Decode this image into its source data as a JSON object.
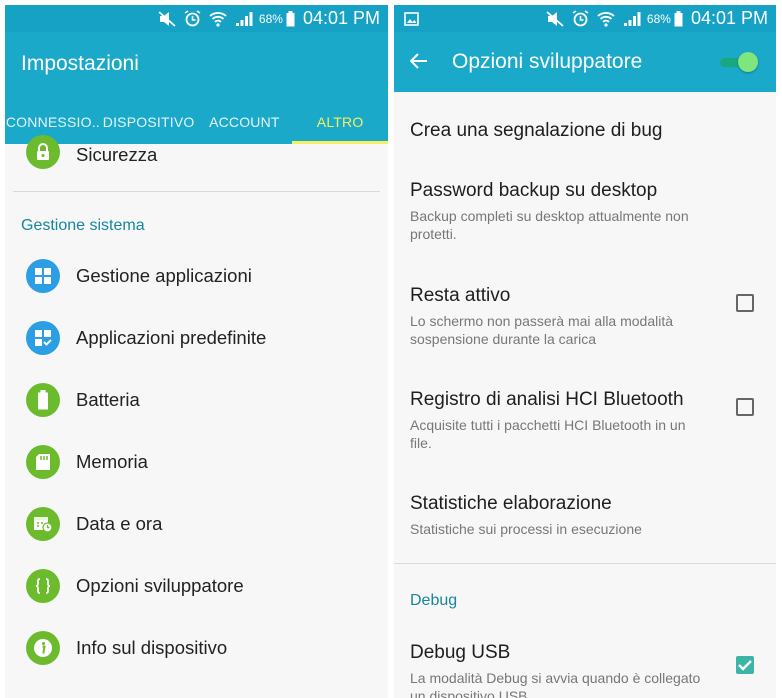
{
  "left": {
    "status": {
      "battery": "68%",
      "time": "04:01 PM"
    },
    "title": "Impostazioni",
    "tabs": [
      {
        "label": "CONNESSIO..",
        "active": false
      },
      {
        "label": "DISPOSITIVO",
        "active": false
      },
      {
        "label": "ACCOUNT",
        "active": false
      },
      {
        "label": "ALTRO",
        "active": true
      }
    ],
    "items_top": [
      {
        "label": "Sicurezza",
        "icon": "lock-icon"
      }
    ],
    "section": "Gestione sistema",
    "items": [
      {
        "label": "Gestione applicazioni",
        "icon": "grid-icon",
        "color": "#2b9ee4"
      },
      {
        "label": "Applicazioni predefinite",
        "icon": "grid-check-icon",
        "color": "#2b9ee4"
      },
      {
        "label": "Batteria",
        "icon": "battery-icon",
        "color": "#6cbb2c"
      },
      {
        "label": "Memoria",
        "icon": "sd-card-icon",
        "color": "#6cbb2c"
      },
      {
        "label": "Data e ora",
        "icon": "calendar-clock-icon",
        "color": "#6cbb2c"
      },
      {
        "label": "Opzioni sviluppatore",
        "icon": "braces-icon",
        "color": "#6cbb2c"
      },
      {
        "label": "Info sul dispositivo",
        "icon": "info-icon",
        "color": "#6cbb2c"
      }
    ]
  },
  "right": {
    "status": {
      "battery": "68%",
      "time": "04:01 PM"
    },
    "title": "Opzioni sviluppatore",
    "master_toggle_on": true,
    "items": [
      {
        "title": "Crea una segnalazione di bug",
        "subtitle": ""
      },
      {
        "title": "Password backup su desktop",
        "subtitle": "Backup completi su desktop attualmente non protetti."
      },
      {
        "title": "Resta attivo",
        "subtitle": "Lo schermo non passerà mai alla modalità sospensione durante la carica",
        "checked": false
      },
      {
        "title": "Registro di analisi HCI Bluetooth",
        "subtitle": "Acquisite tutti i pacchetti HCI Bluetooth in un file.",
        "checked": false
      },
      {
        "title": "Statistiche elaborazione",
        "subtitle": "Statistiche sui processi in esecuzione"
      }
    ],
    "section": "Debug",
    "debug_items": [
      {
        "title": "Debug USB",
        "subtitle": "La modalità Debug si avvia quando è collegato un dispositivo USB",
        "checked": true
      }
    ]
  },
  "colors": {
    "appbar": "#1ba9c9",
    "statusbar": "#16a2c4",
    "tab_active": "#f6ef63",
    "section": "#17879f",
    "icon_green": "#6cbb2c",
    "icon_blue": "#2b9ee4"
  }
}
